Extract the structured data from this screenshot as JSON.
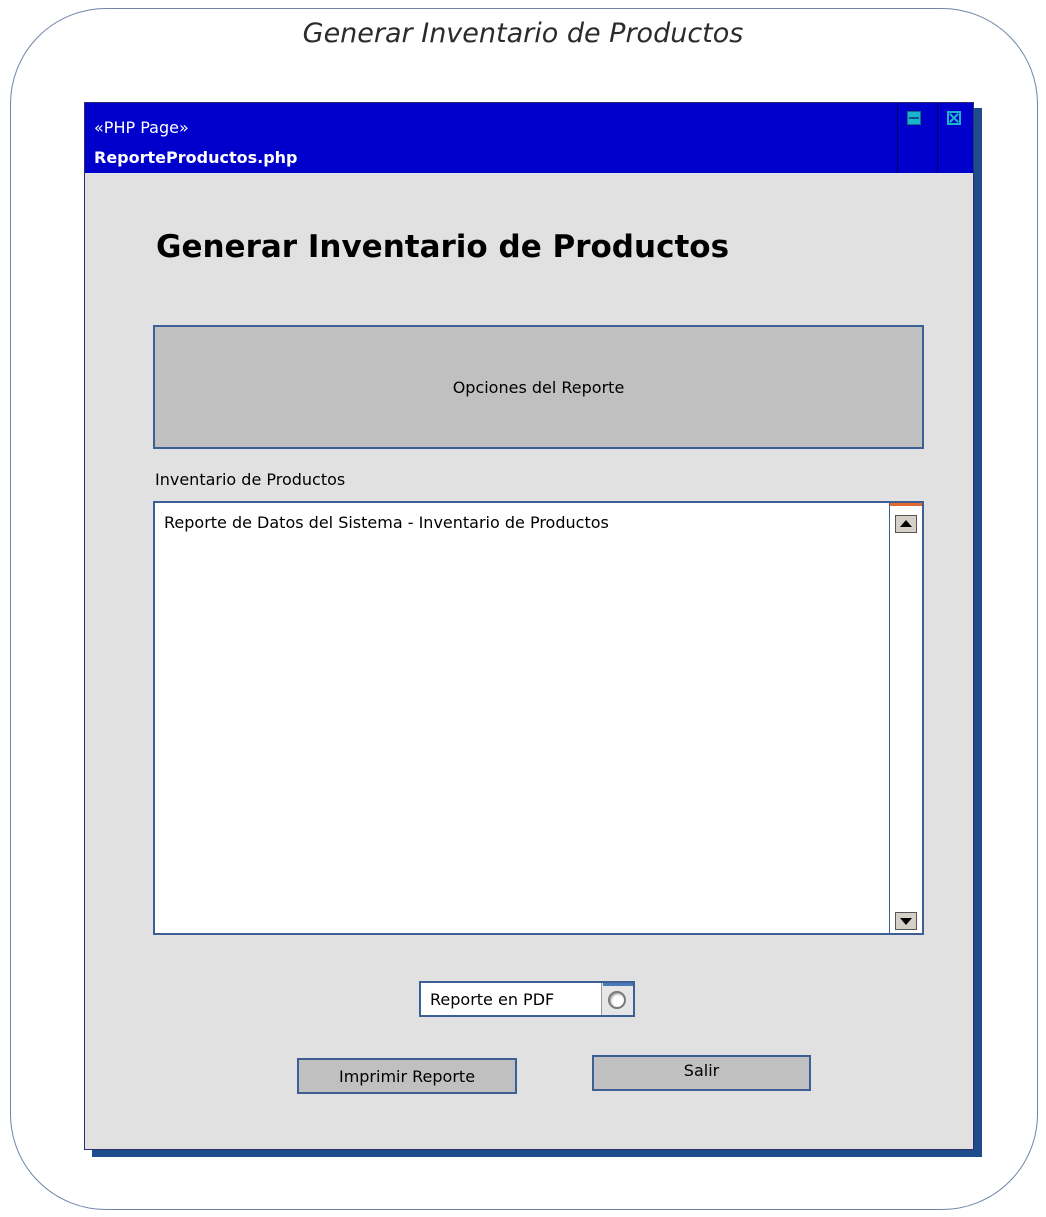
{
  "diagram": {
    "title": "Generar Inventario de Productos"
  },
  "window": {
    "stereotype": "«PHP Page»",
    "filename": "ReporteProductos.php",
    "heading": "Generar Inventario de Productos"
  },
  "options_panel": {
    "label": "Opciones del Reporte"
  },
  "inventory": {
    "label": "Inventario de Productos",
    "content": "Reporte de Datos del Sistema - Inventario de Productos"
  },
  "pdf_option": {
    "label": "Reporte en PDF",
    "checked": false
  },
  "buttons": {
    "print": "Imprimir Reporte",
    "exit": "Salir"
  },
  "colors": {
    "titlebar": "#0000cc",
    "window_bg": "#e1e1e1",
    "panel_bg": "#c0c0c0",
    "border": "#3d5f96",
    "window_controls": "#19b5c8"
  },
  "icons": {
    "maximize": "maximize-icon",
    "close": "close-icon",
    "scroll_up": "scroll-up-arrow-icon",
    "scroll_down": "scroll-down-arrow-icon",
    "radio": "radio-button-icon"
  }
}
